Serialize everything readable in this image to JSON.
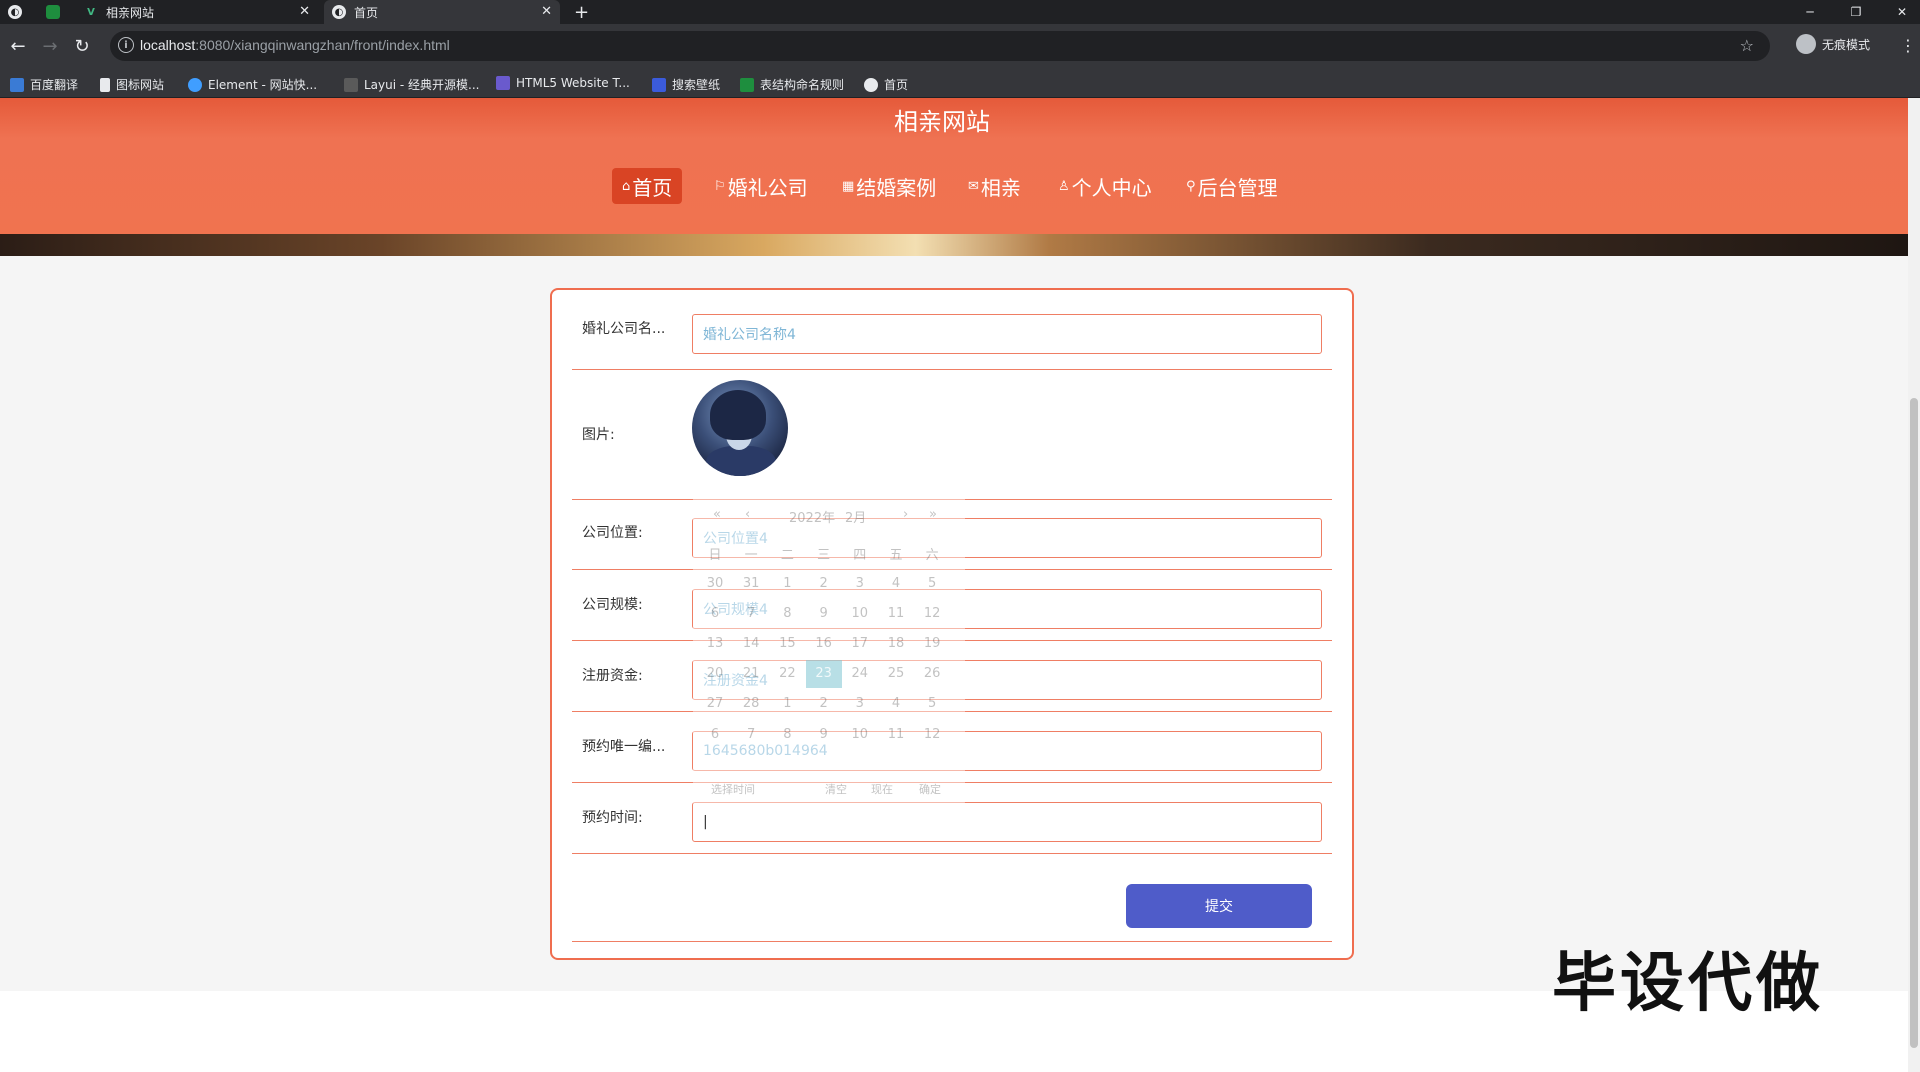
{
  "browser": {
    "tabs": [
      {
        "title": "相亲网站"
      },
      {
        "title": "首页"
      }
    ],
    "url_host": "localhost",
    "url_rest": ":8080/xiangqinwangzhan/front/index.html",
    "profile_label": "无痕模式",
    "bookmarks": [
      "百度翻译",
      "图标网站",
      "Element - 网站快...",
      "Layui - 经典开源模...",
      "HTML5 Website T...",
      "搜索壁纸",
      "表结构命名规则",
      "首页"
    ]
  },
  "site": {
    "title": "相亲网站",
    "nav": [
      {
        "label": "首页",
        "icon": "home-icon",
        "active": true
      },
      {
        "label": "婚礼公司",
        "icon": "flag-icon"
      },
      {
        "label": "结婚案例",
        "icon": "grid-icon"
      },
      {
        "label": "相亲",
        "icon": "mail-icon"
      },
      {
        "label": "个人中心",
        "icon": "user-icon"
      },
      {
        "label": "后台管理",
        "icon": "link-icon"
      }
    ]
  },
  "form": {
    "fields": [
      {
        "label": "婚礼公司名...",
        "value": "婚礼公司名称4"
      },
      {
        "label": "图片:",
        "type": "image"
      },
      {
        "label": "公司位置:",
        "value": "公司位置4"
      },
      {
        "label": "公司规模:",
        "value": "公司规模4"
      },
      {
        "label": "注册资金:",
        "value": "注册资金4"
      },
      {
        "label": "预约唯一编...",
        "value": "1645680b014964"
      },
      {
        "label": "预约时间:",
        "value": "|"
      }
    ],
    "submit_label": "提交"
  },
  "datepicker": {
    "year_label": "2022年",
    "month_label": "2月",
    "weekdays": [
      "日",
      "一",
      "二",
      "三",
      "四",
      "五",
      "六"
    ],
    "days": [
      [
        "30",
        "31",
        "1",
        "2",
        "3",
        "4",
        "5"
      ],
      [
        "6",
        "7",
        "8",
        "9",
        "10",
        "11",
        "12"
      ],
      [
        "13",
        "14",
        "15",
        "16",
        "17",
        "18",
        "19"
      ],
      [
        "20",
        "21",
        "22",
        "23",
        "24",
        "25",
        "26"
      ],
      [
        "27",
        "28",
        "1",
        "2",
        "3",
        "4",
        "5"
      ],
      [
        "6",
        "7",
        "8",
        "9",
        "10",
        "11",
        "12"
      ]
    ],
    "selected": "23",
    "footer": {
      "select_time": "选择时间",
      "clear": "清空",
      "now": "现在",
      "confirm": "确定"
    }
  },
  "watermark": "毕设代做"
}
